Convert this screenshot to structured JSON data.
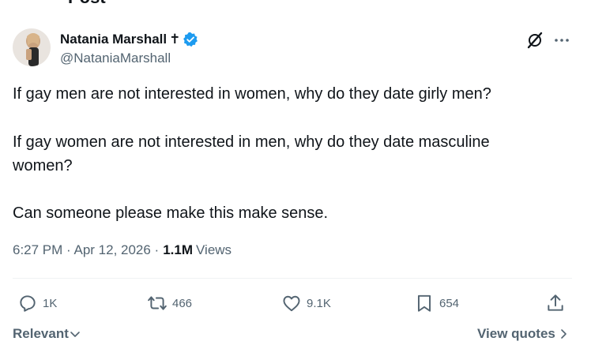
{
  "header": {
    "title": "Post"
  },
  "author": {
    "name": "Natania Marshall",
    "name_symbol": "✝",
    "handle": "@NataniaMarshall",
    "verified_color": "#1d9bf0"
  },
  "post": {
    "paragraph_1": "If gay men are not interested in women, why do they date girly men?",
    "paragraph_2": "If gay women are not interested in men, why do they date masculine women?",
    "paragraph_3": "Can someone please make this make sense.",
    "timestamp": "6:27 PM · Apr 12, 2026 ·",
    "views_count": "1.1M",
    "views_label": "Views"
  },
  "actions": {
    "replies": "1K",
    "reposts": "466",
    "likes": "9.1K",
    "bookmarks": "654"
  },
  "footer": {
    "sort_label": "Relevant",
    "quotes_label": "View quotes"
  },
  "icons": [
    "back-arrow-icon",
    "verified-badge-icon",
    "grok-icon",
    "more-icon",
    "reply-icon",
    "repost-icon",
    "like-icon",
    "bookmark-icon",
    "share-icon",
    "chevron-down-icon",
    "chevron-right-icon"
  ]
}
